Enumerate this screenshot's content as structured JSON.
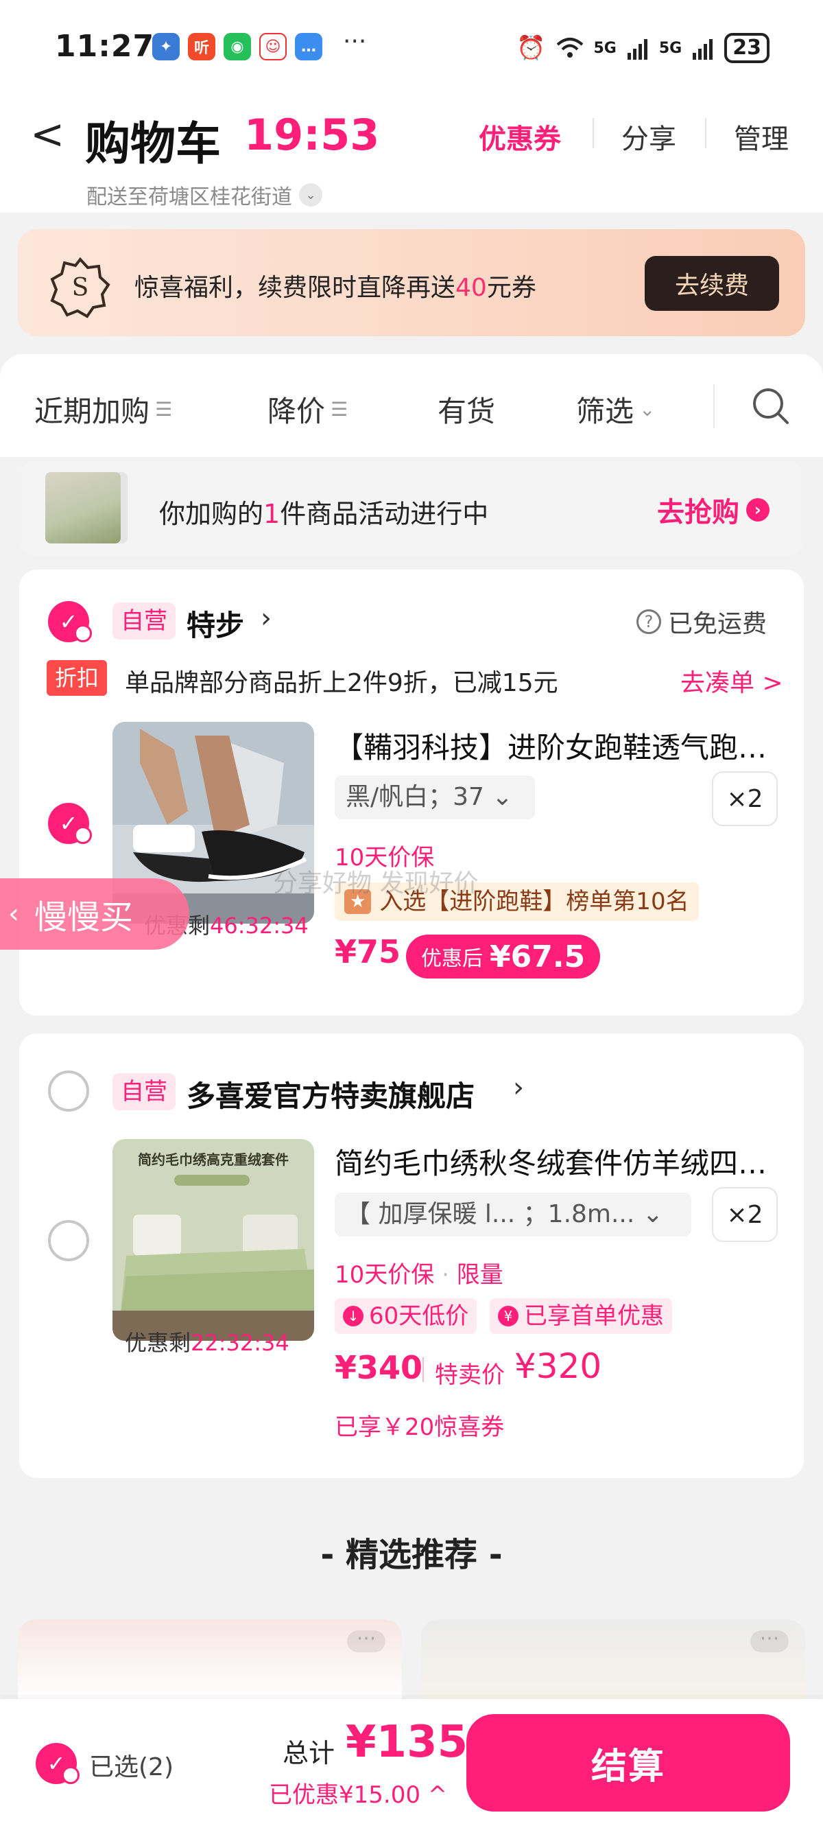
{
  "status_bar": {
    "time": "11:27",
    "more": "···",
    "net1": "5G",
    "net2": "5G",
    "battery": "23"
  },
  "header": {
    "back_glyph": "<",
    "title": "购物车",
    "timer": "19:53",
    "links": [
      "优惠券",
      "分享",
      "管理"
    ],
    "address": "配送至荷塘区桂花街道"
  },
  "promo": {
    "text_a": "惊喜福利，续费限时直降再送",
    "text_num": "40",
    "text_b": "元券",
    "button": "去续费"
  },
  "filters": [
    {
      "label": "近期加购",
      "sub": "☰"
    },
    {
      "label": "降价",
      "sub": "☰"
    },
    {
      "label": "有货",
      "sub": ""
    },
    {
      "label": "筛选",
      "sub": "⌄"
    }
  ],
  "notice": {
    "text_a": "你加购的",
    "count": "1",
    "text_b": "件商品活动进行中",
    "action": "去抢购"
  },
  "store1": {
    "badge": "自营",
    "name": "特步",
    "shipping": "已免运费",
    "discount_tag": "折扣",
    "discount_text": "单品牌部分商品折上2件9折，已减15元",
    "discount_go": "去凑单 >",
    "item": {
      "title": "【鞴羽科技】进阶女跑鞋透气跑步鞋",
      "spec": "黑/帆白；37",
      "qty": "×2",
      "guarantee": "10天价保",
      "rank": "入选【进阶跑鞋】榜单第10名",
      "price": "¥75",
      "after_label": "优惠后",
      "after_price": "¥67.5",
      "countdown_label": "优惠剩",
      "countdown": "46:32:34"
    }
  },
  "store2": {
    "badge": "自营",
    "name": "多喜爱官方特卖旗舰店",
    "item": {
      "title": "简约毛巾绣秋冬绒套件仿羊绒四件套",
      "spec": "【 加厚保暖 l... ；1.8m...",
      "qty": "×2",
      "guarantee": "10天价保",
      "limited": "限量",
      "tag1": "60天低价",
      "tag2": "已享首单优惠",
      "price": "¥340",
      "special_label": "特卖价",
      "special_price": "¥320",
      "coupon": "已享￥20惊喜券",
      "countdown_label": "优惠剩",
      "countdown": "22:32:34",
      "thumb_title": "简约毛巾绣高克重绒套件"
    }
  },
  "floating": {
    "label": "慢慢买",
    "watermark": "分享好物 发现好价"
  },
  "recommend": {
    "title": "- 精选推荐 -",
    "more": "···"
  },
  "bottom": {
    "selected": "已选(2)",
    "total_label": "总计",
    "total": "¥135",
    "saved": "已优惠¥15.00 ^",
    "checkout": "结算"
  },
  "colors": {
    "accent": "#ff1f78",
    "promo_bg": "#fbd8c6",
    "renew_btn": "#2a1f1c"
  }
}
